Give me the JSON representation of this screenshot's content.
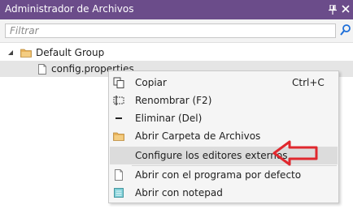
{
  "window": {
    "title": "Administrador de Archivos"
  },
  "filter": {
    "placeholder": "Filtrar"
  },
  "tree": {
    "group_label": "Default Group",
    "file_label": "config.properties"
  },
  "context_menu": {
    "copy": {
      "label": "Copiar",
      "shortcut": "Ctrl+C"
    },
    "rename": "Renombrar (F2)",
    "delete": "Eliminar (Del)",
    "open_folder": "Abrir Carpeta de Archivos",
    "configure_editors": "Configure los editores externos",
    "open_default": "Abrir con el programa por defecto",
    "open_notepad": "Abrir con notepad"
  },
  "colors": {
    "titlebar": "#6b4c8a",
    "highlight_arrow": "#e0282e",
    "folder": "#e8b25a",
    "accent_blue": "#1e6fd9"
  },
  "icons": [
    "pin-icon",
    "close-icon",
    "search-icon",
    "expander-icon",
    "folder-icon",
    "file-icon",
    "copy-icon",
    "rename-icon",
    "delete-icon",
    "notepad-icon",
    "arrow-icon"
  ]
}
